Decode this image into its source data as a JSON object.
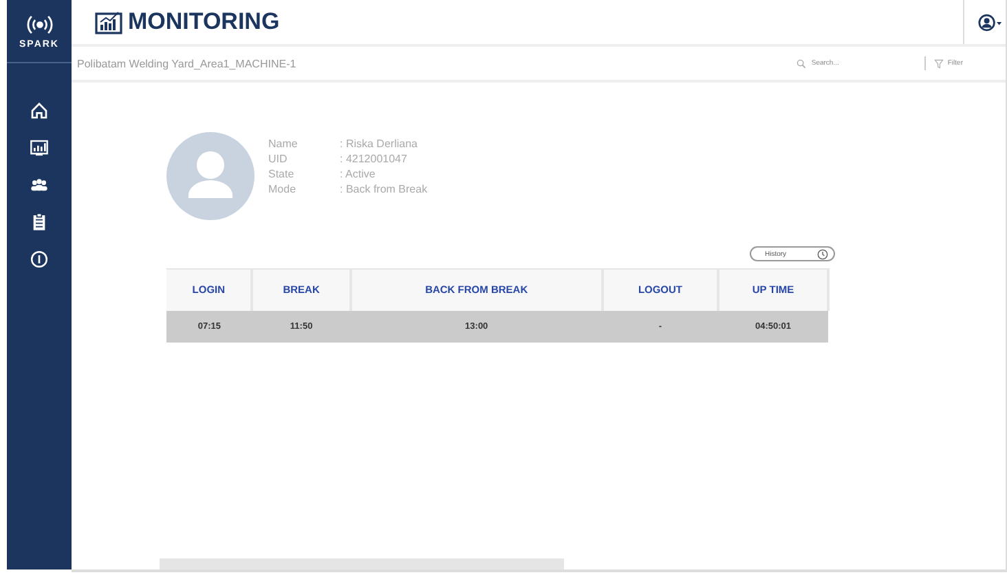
{
  "logo": {
    "text": "SPARK"
  },
  "header": {
    "title": "MONITORING"
  },
  "breadcrumb": "Polibatam Welding Yard_Area1_MACHINE-1",
  "search": {
    "placeholder": "Search..."
  },
  "filter": {
    "label": "Filter"
  },
  "sidebar": {
    "items": [
      {
        "kind": "home"
      },
      {
        "kind": "monitoring"
      },
      {
        "kind": "team"
      },
      {
        "kind": "clipboard"
      },
      {
        "kind": "info"
      }
    ]
  },
  "profile": {
    "fields": [
      {
        "label": "Name",
        "value": ": Riska Derliana"
      },
      {
        "label": "UID",
        "value": ": 4212001047"
      },
      {
        "label": "State",
        "value": ": Active"
      },
      {
        "label": "Mode",
        "value": ": Back from Break"
      }
    ]
  },
  "history_button": "History",
  "table": {
    "columns": [
      "LOGIN",
      "BREAK",
      "BACK FROM BREAK",
      "LOGOUT",
      "UP TIME"
    ],
    "rows": [
      [
        "07:15",
        "11:50",
        "13:00",
        "-",
        "04:50:01"
      ]
    ]
  }
}
